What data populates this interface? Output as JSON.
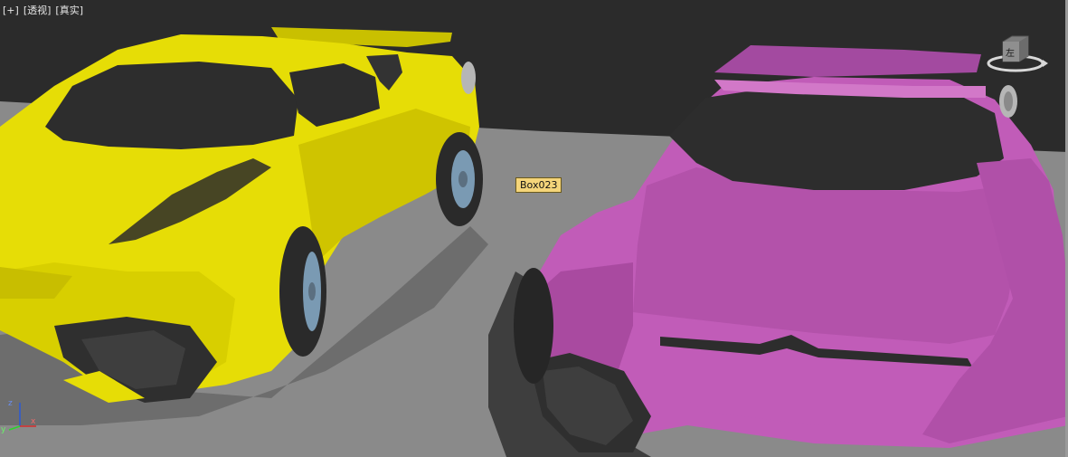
{
  "viewport": {
    "labels": [
      "[+]",
      "[透视]",
      "[真实]"
    ],
    "tooltip": "Box023",
    "viewcube_face": "左",
    "axes": {
      "x": "x",
      "y": "y",
      "z": "z"
    },
    "colors": {
      "background": "#2b2b2b",
      "ground": "#8a8a8a",
      "car_yellow": "#e6dd06",
      "car_magenta": "#c15cb8",
      "tooltip_bg": "#f5d57a"
    }
  }
}
